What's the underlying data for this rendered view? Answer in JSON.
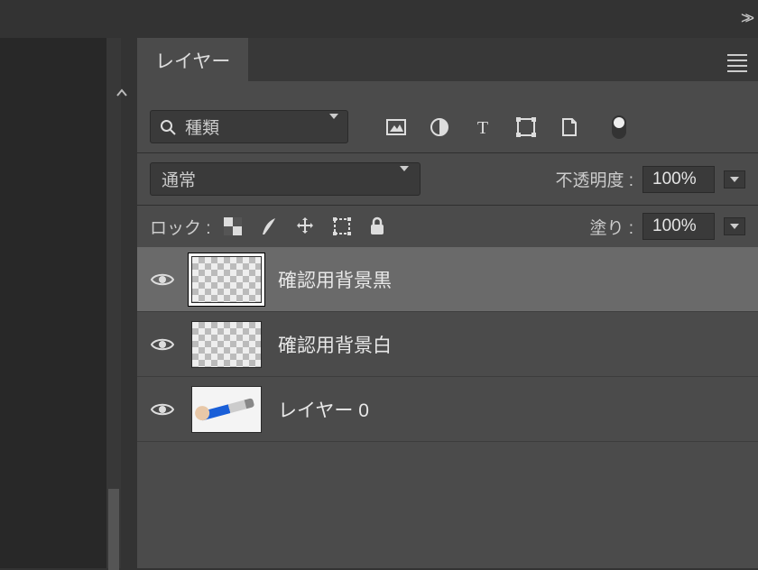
{
  "header": {
    "expand_chevron": ">>"
  },
  "panel": {
    "tab_label": "レイヤー",
    "filter": {
      "search_label": "種類"
    },
    "blend": {
      "mode": "通常",
      "opacity_label": "不透明度 :",
      "opacity_value": "100%"
    },
    "lock": {
      "label": "ロック :",
      "fill_label": "塗り :",
      "fill_value": "100%"
    },
    "layers": [
      {
        "name": "確認用背景黒",
        "visible": true,
        "selected": true,
        "thumb": "checker"
      },
      {
        "name": "確認用背景白",
        "visible": true,
        "selected": false,
        "thumb": "checker"
      },
      {
        "name": "レイヤー 0",
        "visible": true,
        "selected": false,
        "thumb": "image"
      }
    ]
  },
  "icons": {
    "search": "search-icon",
    "image_filter": "image-filter-icon",
    "adjustment_filter": "adjustment-filter-icon",
    "type_filter": "type-filter-icon",
    "shape_filter": "shape-filter-icon",
    "smartobject_filter": "smart-object-filter-icon",
    "artboard_toggle": "artboard-toggle-icon",
    "lock_pixels": "lock-transparent-icon",
    "lock_brush": "lock-image-icon",
    "lock_move": "lock-position-icon",
    "lock_artboard": "lock-artboard-icon",
    "lock_all": "lock-all-icon",
    "eye": "visibility-icon"
  }
}
